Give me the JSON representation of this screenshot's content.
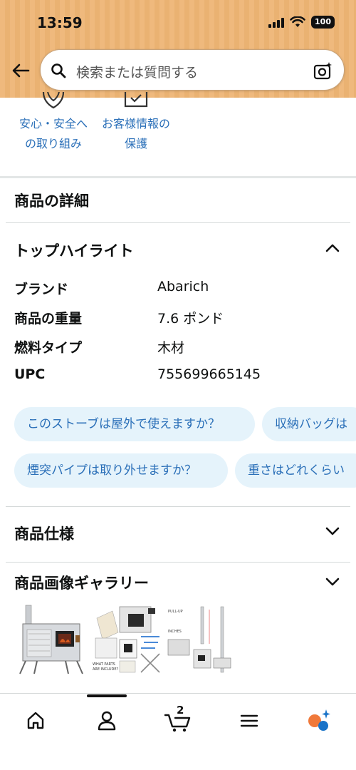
{
  "status": {
    "time": "13:59",
    "battery": "100"
  },
  "search": {
    "placeholder": "検索または質問する"
  },
  "trust": {
    "items": [
      {
        "line1": "安心・安全へ",
        "line2": "の取り組み"
      },
      {
        "line1": "お客様情報の",
        "line2": "保護"
      }
    ]
  },
  "details": {
    "title": "商品の詳細",
    "highlights_title": "トップハイライト",
    "specs": [
      {
        "key": "ブランド",
        "value": "Abarich"
      },
      {
        "key": "商品の重量",
        "value": "7.6 ポンド"
      },
      {
        "key": "燃料タイプ",
        "value": "木材"
      },
      {
        "key": "UPC",
        "value": "755699665145"
      }
    ],
    "chips": [
      "このストーブは屋外で使えますか？",
      "収納バッグは",
      "煙突パイプは取り外せますか？",
      "重さはどれくらい"
    ],
    "specs_section_title": "商品仕様",
    "gallery_title": "商品画像ギャラリー"
  },
  "gallery": {
    "thumb2_caption": "WHAT PARTS ARE INCLUDE?",
    "thumb3_labels": [
      "PULL-UP",
      "INCHES"
    ]
  },
  "nav": {
    "cart_count": "2"
  },
  "colors": {
    "link": "#2a6fb8",
    "chip_bg": "#e5f3fb",
    "header": "#efb97d"
  }
}
